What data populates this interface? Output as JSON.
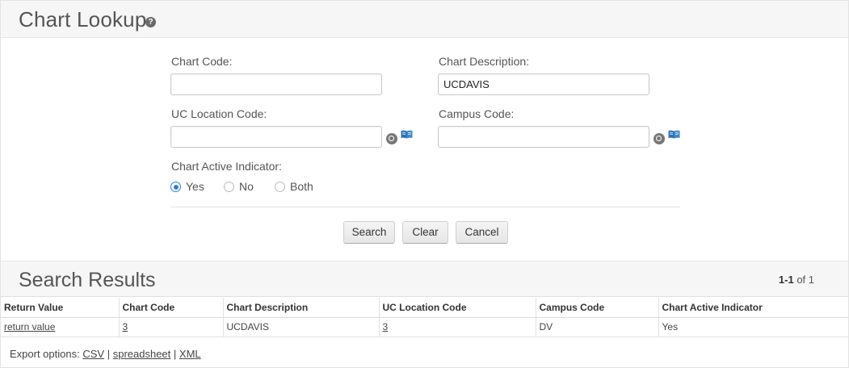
{
  "header": {
    "title": "Chart Lookup",
    "help_icon": "question-circle-icon"
  },
  "form": {
    "chart_code": {
      "label": "Chart Code:",
      "value": ""
    },
    "chart_description": {
      "label": "Chart Description:",
      "value": "UCDAVIS"
    },
    "uc_location_code": {
      "label": "UC Location Code:",
      "value": ""
    },
    "campus_code": {
      "label": "Campus Code:",
      "value": ""
    },
    "active_indicator": {
      "label": "Chart Active Indicator:",
      "options": [
        "Yes",
        "No",
        "Both"
      ],
      "selected": "Yes"
    },
    "lookup_icons": [
      "search-lookup-icon",
      "book-inquiry-icon"
    ]
  },
  "buttons": {
    "search": "Search",
    "clear": "Clear",
    "cancel": "Cancel"
  },
  "results": {
    "title": "Search Results",
    "range": "1-1",
    "of_text": "of 1",
    "columns": [
      "Return Value",
      "Chart Code",
      "Chart Description",
      "UC Location Code",
      "Campus Code",
      "Chart Active Indicator"
    ],
    "rows": [
      [
        "return value",
        "3",
        "UCDAVIS",
        "3",
        "DV",
        "Yes"
      ]
    ]
  },
  "export": {
    "prefix": "Export options:",
    "csv": "CSV",
    "spreadsheet": "spreadsheet",
    "xml": "XML",
    "separator": "|"
  },
  "colors": {
    "radio_accent": "#2d7fd6",
    "header_bg": "#f6f6f6"
  }
}
